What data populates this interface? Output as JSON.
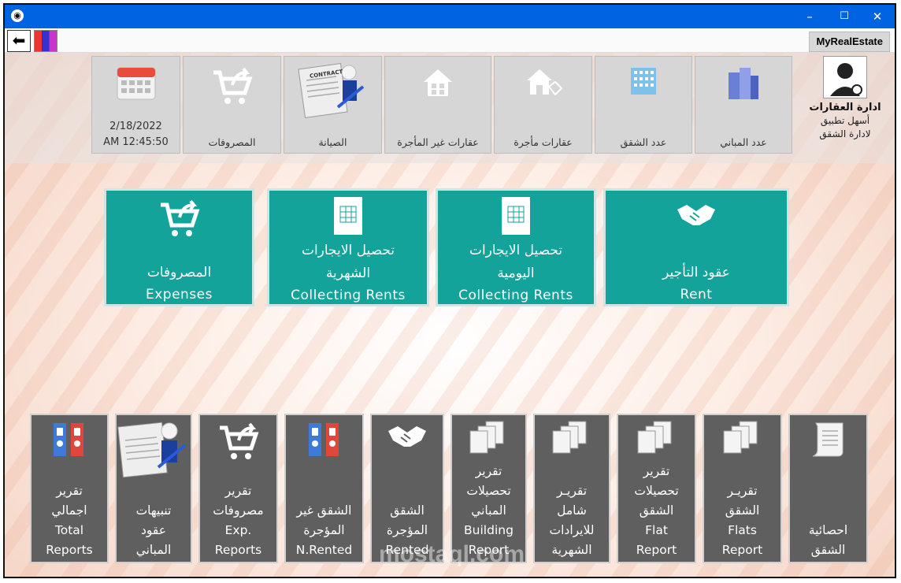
{
  "titlebar": {
    "minimize": "–",
    "maximize": "☐",
    "close": "✕"
  },
  "toolbar": {
    "back_glyph": "⬅",
    "brand": "MyRealEstate"
  },
  "user": {
    "title": "ادارة العقارات",
    "line1": "أسهل تطبيق",
    "line2": "لادارة الشقق"
  },
  "stats": {
    "buildings": "عدد المباني",
    "flats": "عدد الشقق",
    "rented": "عقارات مأجرة",
    "not_rented": "عقارات غير المأجرة",
    "maintenance": "الصيانة",
    "expenses": "المصروفات",
    "date": "2/18/2022",
    "time": "AM 12:45:50",
    "contract_word": "CONTRACT"
  },
  "main": {
    "rent_ar": "عقود التأجير",
    "rent_en": "Rent",
    "daily_ar1": "تحصيل الايجارات",
    "daily_ar2": "اليومية",
    "daily_en": "Collecting Rents",
    "monthly_ar1": "تحصيل الايجارات",
    "monthly_ar2": "الشهرية",
    "monthly_en": "Collecting Rents",
    "expenses_ar": "المصروفات",
    "expenses_en": "Expenses"
  },
  "reports": {
    "flat_stats": [
      "احصائية",
      "الشقق"
    ],
    "flats": [
      "تقريـر",
      "الشقق",
      "Flats",
      "Report"
    ],
    "flat_collect": [
      "تقرير",
      "تحصيلات",
      "الشقق",
      "Flat",
      "Report"
    ],
    "monthly_all": [
      "تقريـر",
      "شامل",
      "للايرادات",
      "الشهرية"
    ],
    "building_collect": [
      "تقرير",
      "تحصيلات",
      "المباني",
      "Building",
      "Report"
    ],
    "rented": [
      "الشقق",
      "المؤجرة",
      "Rented"
    ],
    "not_rented": [
      "الشقق غير",
      "المؤجرة",
      "N.Rented"
    ],
    "expenses": [
      "تقرير",
      "مصروفات",
      "Exp.",
      "Reports"
    ],
    "building_alerts": [
      "تنبيهات",
      "عقود",
      "المباني"
    ],
    "total": [
      "تقرير",
      "اجمالي",
      "Total",
      "Reports"
    ]
  },
  "watermark": "mostaql.com"
}
